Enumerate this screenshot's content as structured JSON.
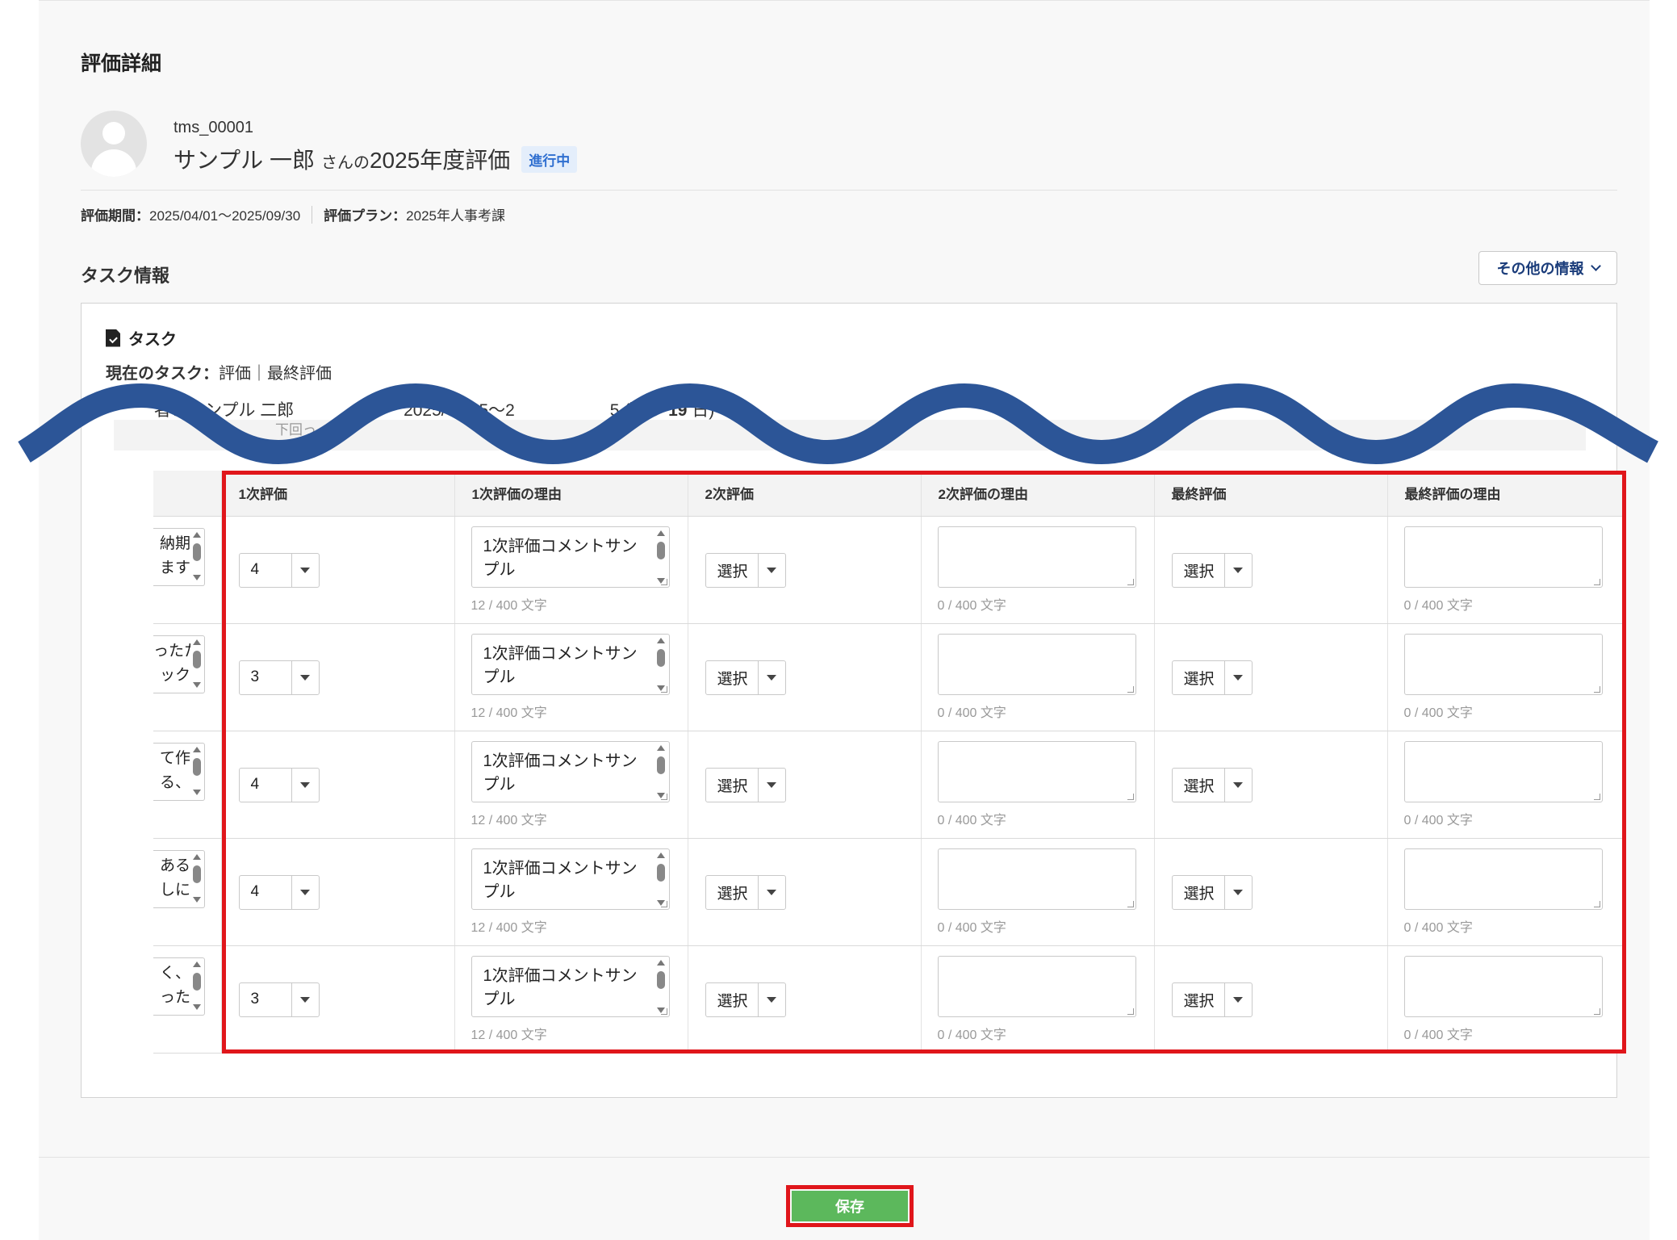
{
  "page": {
    "title": "評価詳細"
  },
  "user": {
    "id": "tms_00001",
    "name": "サンプル 一郎",
    "suffix": "さんの",
    "evaluation_label": "2025年度評価",
    "status": "進行中"
  },
  "meta": {
    "period_label": "評価期間：",
    "period_value": "2025/04/01～2025/09/30",
    "plan_label": "評価プラン：",
    "plan_value": "2025年人事考課"
  },
  "task_section": {
    "title": "タスク情報",
    "other_info_button": "その他の情報",
    "card_title": "タスク",
    "current_task_label": "現在のタスク：",
    "current_task_value": "評価｜最終評価",
    "assignee_prefix": "者：サンプル 二郎",
    "period": "2025/08/25～2",
    "period_tail": "5 (残り",
    "remaining_days": "19",
    "remaining_unit": "日)",
    "sub_note": "下回っ"
  },
  "table": {
    "columns": [
      "1次評価",
      "1次評価の理由",
      "2次評価",
      "2次評価の理由",
      "最終評価",
      "最終評価の理由"
    ],
    "rows": [
      {
        "stub": [
          "納期",
          "ます"
        ],
        "score1": "4",
        "reason1": "1次評価コメントサンプル",
        "count1": "12 / 400 文字",
        "score2": "選択",
        "count2": "0 / 400 文字",
        "score_final": "選択",
        "count_final": "0 / 400 文字"
      },
      {
        "stub": [
          "ったた",
          "ック"
        ],
        "score1": "3",
        "reason1": "1次評価コメントサンプル",
        "count1": "12 / 400 文字",
        "score2": "選択",
        "count2": "0 / 400 文字",
        "score_final": "選択",
        "count_final": "0 / 400 文字"
      },
      {
        "stub": [
          "て作",
          "る、"
        ],
        "score1": "4",
        "reason1": "1次評価コメントサンプル",
        "count1": "12 / 400 文字",
        "score2": "選択",
        "count2": "0 / 400 文字",
        "score_final": "選択",
        "count_final": "0 / 400 文字"
      },
      {
        "stub": [
          "ある",
          "しに"
        ],
        "score1": "4",
        "reason1": "1次評価コメントサンプル",
        "count1": "12 / 400 文字",
        "score2": "選択",
        "count2": "0 / 400 文字",
        "score_final": "選択",
        "count_final": "0 / 400 文字"
      },
      {
        "stub": [
          "く、",
          "った"
        ],
        "score1": "3",
        "reason1": "1次評価コメントサンプル",
        "count1": "12 / 400 文字",
        "score2": "選択",
        "count2": "0 / 400 文字",
        "score_final": "選択",
        "count_final": "0 / 400 文字"
      }
    ]
  },
  "footer": {
    "save_button": "保存"
  },
  "colors": {
    "accent_red": "#e0161b",
    "save_green": "#5cb85c",
    "wave_blue": "#2c5597",
    "badge_blue": "#2f6fd0"
  }
}
